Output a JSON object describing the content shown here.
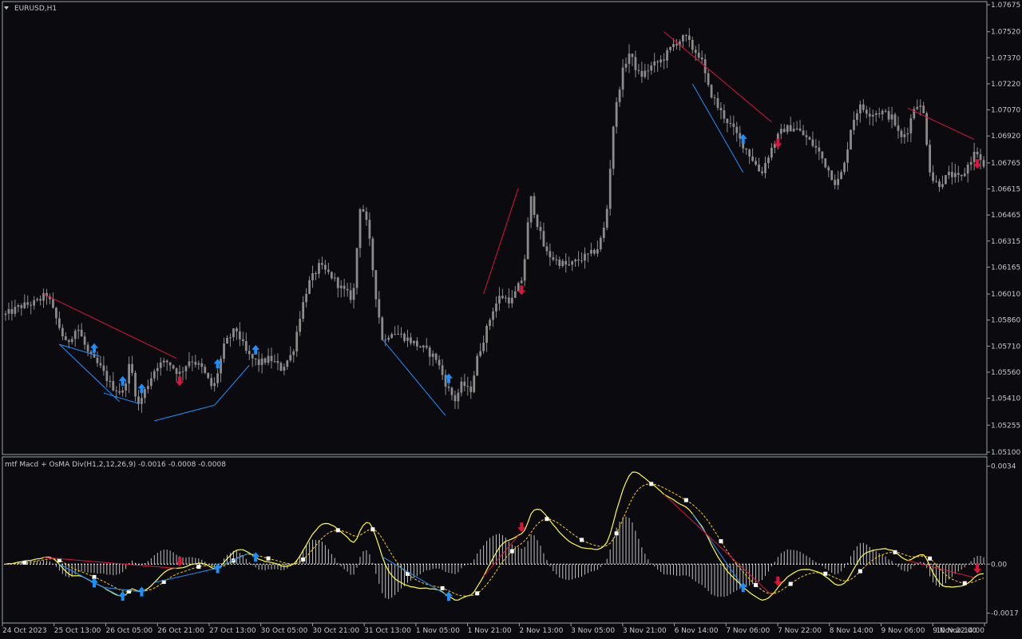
{
  "window": {
    "symbol_title": "EURUSD,H1",
    "indicator_title": "mtf Macd + OsMA Div(H1,2,12,26,9) -0.0016 -0.0008 -0.0008"
  },
  "colors": {
    "background": "#0b0b0f",
    "frame": "#9aa0a8",
    "candle": "#8c8c8c",
    "bull_signal": "#1e8fff",
    "bear_signal": "#dc143c",
    "macd_line": "#ffff3a",
    "signal_line": "#ffd000",
    "histogram": "#c0c0c0",
    "marker": "#ffffff"
  },
  "icons": {
    "buy": "arrow-up-icon",
    "sell": "arrow-down-icon",
    "menu": "triangle-down-icon"
  },
  "chart_data": [
    {
      "type": "candlestick",
      "title": "EURUSD,H1",
      "y_ticks": [
        "1.07675",
        "1.07520",
        "1.07370",
        "1.07220",
        "1.07070",
        "1.06920",
        "1.06765",
        "1.06615",
        "1.06465",
        "1.06315",
        "1.06165",
        "1.06010",
        "1.05860",
        "1.05710",
        "1.05560",
        "1.05410",
        "1.05255",
        "1.05100"
      ],
      "ylim": [
        1.051,
        1.07675
      ],
      "x_ticks": [
        "24 Oct 2023",
        "25 Oct 13:00",
        "26 Oct 05:00",
        "26 Oct 21:00",
        "27 Oct 13:00",
        "30 Oct 05:00",
        "30 Oct 21:00",
        "31 Oct 13:00",
        "1 Nov 05:00",
        "1 Nov 21:00",
        "2 Nov 13:00",
        "3 Nov 05:00",
        "3 Nov 21:00",
        "6 Nov 14:00",
        "7 Nov 06:00",
        "7 Nov 22:00",
        "8 Nov 14:00",
        "9 Nov 06:00",
        "9 Nov 22:00",
        "10 Nov 14:00"
      ],
      "close_path": [
        [
          0,
          1.0589
        ],
        [
          4,
          1.0594
        ],
        [
          8,
          1.0596
        ],
        [
          11,
          1.0601
        ],
        [
          13,
          1.0589
        ],
        [
          16,
          1.0572
        ],
        [
          19,
          1.0582
        ],
        [
          22,
          1.0566
        ],
        [
          25,
          1.0559
        ],
        [
          28,
          1.0548
        ],
        [
          31,
          1.0544
        ],
        [
          33,
          1.0562
        ],
        [
          35,
          1.0536
        ],
        [
          37,
          1.0546
        ],
        [
          40,
          1.056
        ],
        [
          43,
          1.0562
        ],
        [
          46,
          1.0555
        ],
        [
          49,
          1.0564
        ],
        [
          52,
          1.0558
        ],
        [
          55,
          1.0546
        ],
        [
          58,
          1.0572
        ],
        [
          61,
          1.0581
        ],
        [
          64,
          1.0566
        ],
        [
          67,
          1.0561
        ],
        [
          70,
          1.0564
        ],
        [
          73,
          1.0558
        ],
        [
          76,
          1.0567
        ],
        [
          78,
          1.0589
        ],
        [
          80,
          1.0606
        ],
        [
          83,
          1.0617
        ],
        [
          86,
          1.0612
        ],
        [
          89,
          1.0604
        ],
        [
          92,
          1.0598
        ],
        [
          94,
          1.0655
        ],
        [
          96,
          1.0638
        ],
        [
          98,
          1.0601
        ],
        [
          100,
          1.0572
        ],
        [
          102,
          1.058
        ],
        [
          105,
          1.0577
        ],
        [
          108,
          1.0573
        ],
        [
          111,
          1.0569
        ],
        [
          114,
          1.0564
        ],
        [
          117,
          1.0547
        ],
        [
          119,
          1.054
        ],
        [
          121,
          1.055
        ],
        [
          123,
          1.0544
        ],
        [
          125,
          1.0565
        ],
        [
          127,
          1.0578
        ],
        [
          129,
          1.0592
        ],
        [
          131,
          1.06
        ],
        [
          134,
          1.0597
        ],
        [
          137,
          1.0611
        ],
        [
          139,
          1.0657
        ],
        [
          141,
          1.064
        ],
        [
          143,
          1.0625
        ],
        [
          146,
          1.062
        ],
        [
          149,
          1.0617
        ],
        [
          152,
          1.0621
        ],
        [
          155,
          1.0624
        ],
        [
          157,
          1.0628
        ],
        [
          159,
          1.0643
        ],
        [
          161,
          1.07
        ],
        [
          163,
          1.0726
        ],
        [
          165,
          1.074
        ],
        [
          168,
          1.0726
        ],
        [
          171,
          1.0732
        ],
        [
          174,
          1.0736
        ],
        [
          177,
          1.0745
        ],
        [
          180,
          1.0749
        ],
        [
          182,
          1.0742
        ],
        [
          184,
          1.0738
        ],
        [
          186,
          1.072
        ],
        [
          189,
          1.0707
        ],
        [
          192,
          1.0698
        ],
        [
          195,
          1.0688
        ],
        [
          198,
          1.0678
        ],
        [
          200,
          1.067
        ],
        [
          202,
          1.0681
        ],
        [
          204,
          1.069
        ],
        [
          206,
          1.0696
        ],
        [
          209,
          1.0697
        ],
        [
          212,
          1.0691
        ],
        [
          215,
          1.0684
        ],
        [
          218,
          1.0672
        ],
        [
          220,
          1.0664
        ],
        [
          222,
          1.0674
        ],
        [
          224,
          1.0699
        ],
        [
          226,
          1.0709
        ],
        [
          229,
          1.0705
        ],
        [
          232,
          1.0706
        ],
        [
          235,
          1.0702
        ],
        [
          237,
          1.069
        ],
        [
          239,
          1.0696
        ],
        [
          241,
          1.0712
        ],
        [
          243,
          1.0706
        ],
        [
          245,
          1.0668
        ],
        [
          247,
          1.0664
        ],
        [
          250,
          1.067
        ],
        [
          253,
          1.0667
        ],
        [
          255,
          1.0676
        ],
        [
          257,
          1.0684
        ],
        [
          259,
          1.0673
        ]
      ],
      "candles": 260,
      "signals": [
        {
          "type": "buy",
          "bar": 28
        },
        {
          "type": "buy",
          "bar": 37
        },
        {
          "type": "buy",
          "bar": 43
        },
        {
          "type": "sell",
          "bar": 55
        },
        {
          "type": "buy",
          "bar": 67
        },
        {
          "type": "buy",
          "bar": 79
        },
        {
          "type": "buy",
          "bar": 140
        },
        {
          "type": "sell",
          "bar": 163
        },
        {
          "type": "sell",
          "bar": 244
        },
        {
          "type": "buy",
          "bar": 233
        },
        {
          "type": "sell",
          "bar": 307
        }
      ],
      "divergence_lines": [
        {
          "type": "bear",
          "points": [
            [
              12,
              1.0601
            ],
            [
              54,
              1.0564
            ]
          ]
        },
        {
          "type": "bull",
          "points": [
            [
              17,
              1.0572
            ],
            [
              30,
              1.0565
            ]
          ]
        },
        {
          "type": "bull",
          "points": [
            [
              17,
              1.0572
            ],
            [
              36,
              1.0539
            ]
          ]
        },
        {
          "type": "bull",
          "points": [
            [
              31,
              1.0544
            ],
            [
              42,
              1.0538
            ]
          ]
        },
        {
          "type": "bull",
          "points": [
            [
              47,
              1.0528
            ],
            [
              66,
              1.0537
            ]
          ]
        },
        {
          "type": "bull",
          "points": [
            [
              66,
              1.0537
            ],
            [
              77,
              1.056
            ]
          ]
        },
        {
          "type": "bull",
          "points": [
            [
              119,
              1.0575
            ],
            [
              139,
              1.0531
            ]
          ]
        },
        {
          "type": "bear",
          "points": [
            [
              151,
              1.0601
            ],
            [
              162,
              1.0662
            ]
          ]
        },
        {
          "type": "bull",
          "points": [
            [
              217,
              1.0722
            ],
            [
              233,
              1.0671
            ]
          ]
        },
        {
          "type": "bear",
          "points": [
            [
              208,
              1.0752
            ],
            [
              242,
              1.07
            ]
          ]
        },
        {
          "type": "bear",
          "points": [
            [
              285,
              1.0708
            ],
            [
              306,
              1.069
            ]
          ]
        }
      ]
    },
    {
      "type": "macd",
      "title": "mtf Macd + OsMA Div(H1,2,12,26,9)",
      "values": {
        "macd": -0.0016,
        "signal": -0.0008,
        "osma": -0.0008
      },
      "y_ticks": [
        "0.0034",
        "0.00",
        "-0.0017"
      ],
      "ylim": [
        -0.00185,
        0.0035
      ]
    }
  ]
}
